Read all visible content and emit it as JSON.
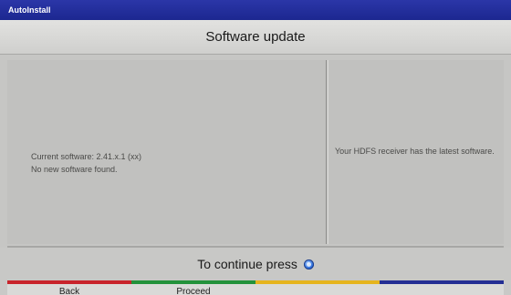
{
  "window": {
    "title": "AutoInstall"
  },
  "header": {
    "title": "Software update"
  },
  "left_panel": {
    "line1": "Current software: 2.41.x.1 (xx)",
    "line2": "No new software found."
  },
  "right_panel": {
    "text": "Your HDFS receiver has the latest software."
  },
  "footer": {
    "continue_text": "To continue press",
    "continue_icon": "ok-button-icon"
  },
  "softkeys": [
    {
      "color": "#c8242b",
      "label": "Back"
    },
    {
      "color": "#23923b",
      "label": "Proceed"
    },
    {
      "color": "#e5b41d",
      "label": ""
    },
    {
      "color": "#242e94",
      "label": ""
    }
  ]
}
